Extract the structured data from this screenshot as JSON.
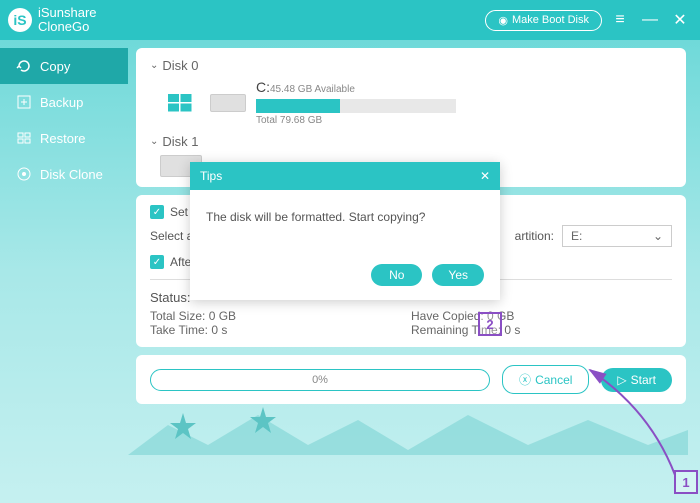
{
  "brand": {
    "line1": "iSunshare",
    "line2": "CloneGo"
  },
  "header": {
    "bootDisk": "Make Boot Disk"
  },
  "nav": {
    "copy": "Copy",
    "backup": "Backup",
    "restore": "Restore",
    "diskClone": "Disk Clone"
  },
  "disk0": {
    "header": "Disk 0",
    "letter": "C:",
    "avail": "45.48 GB Available",
    "total": "Total 79.68 GB",
    "fillPct": 42
  },
  "disk1": {
    "header": "Disk 1"
  },
  "options": {
    "setTarget": "Set the target partition as the boot disk.",
    "selectLabel": "Select a new drive letter for boot partition:",
    "afterCopy": "After the copy is complete,shut down the computer.",
    "partitionLabelStub": "artition:",
    "ddValue": "E:"
  },
  "status": {
    "label": "Status:",
    "totalSize": "Total Size: 0 GB",
    "takeTime": "Take Time: 0 s",
    "haveCopied": "Have Copied: 0 GB",
    "remaining": "Remaining Time: 0 s"
  },
  "footer": {
    "progress": "0%",
    "cancel": "Cancel",
    "start": "Start"
  },
  "tips": {
    "title": "Tips",
    "message": "The disk will be formatted. Start copying?",
    "no": "No",
    "yes": "Yes"
  },
  "annotations": {
    "one": "1",
    "two": "2"
  }
}
